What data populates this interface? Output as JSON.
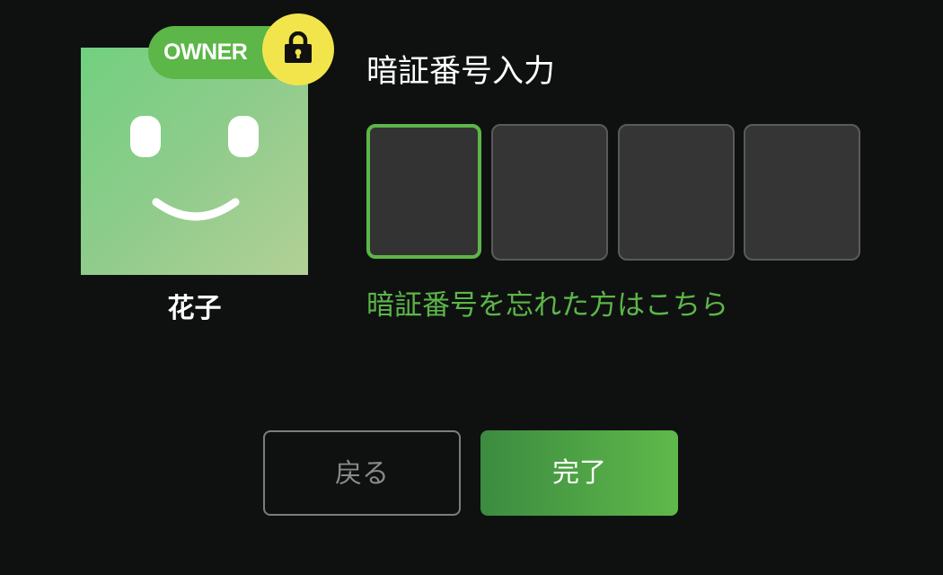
{
  "profile": {
    "name": "花子",
    "badge_label": "OWNER",
    "badge_icon": "lock-icon",
    "avatar_icon": "smiley-face",
    "colors": {
      "badge_bg": "#5cb648",
      "lock_bg": "#f2e54b"
    }
  },
  "pin": {
    "title": "暗証番号入力",
    "digit_count": 4,
    "digits": [
      "",
      "",
      "",
      ""
    ],
    "focused_index": 0,
    "forgot_link": "暗証番号を忘れた方はこちら"
  },
  "buttons": {
    "back_label": "戻る",
    "done_label": "完了"
  },
  "colors": {
    "background": "#0f1111",
    "accent": "#5cb648",
    "pin_box_bg": "#353535"
  }
}
